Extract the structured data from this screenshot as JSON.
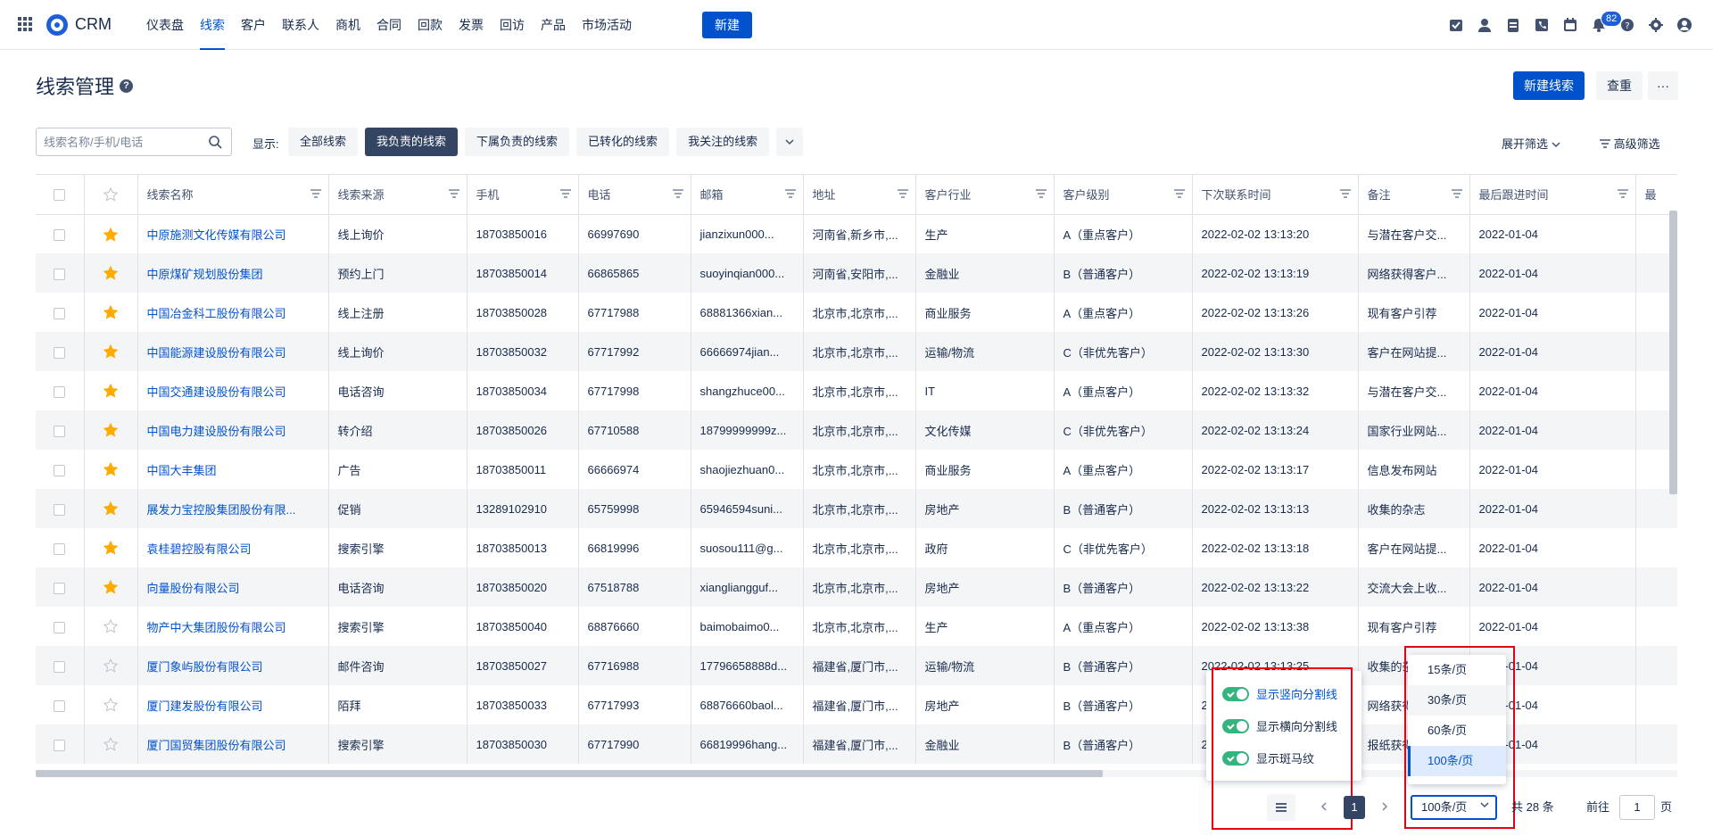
{
  "nav": {
    "brand": "CRM",
    "items": [
      "仪表盘",
      "线索",
      "客户",
      "联系人",
      "商机",
      "合同",
      "回款",
      "发票",
      "回访",
      "产品",
      "市场活动"
    ],
    "active_index": 1,
    "new_label": "新建",
    "notification_count": "82",
    "icons": [
      "task-icon",
      "user-icon",
      "document-icon",
      "phone-icon",
      "calendar-icon",
      "bell-icon",
      "help-icon",
      "gear-icon",
      "avatar-icon"
    ]
  },
  "page": {
    "title": "线索管理",
    "help": "?",
    "new_lead_label": "新建线索",
    "dedupe_label": "查重",
    "more_label": "···"
  },
  "toolbar": {
    "search_placeholder": "线索名称/手机/电话",
    "show_label": "显示:",
    "filters": [
      "全部线索",
      "我负责的线索",
      "下属负责的线索",
      "已转化的线索",
      "我关注的线索"
    ],
    "active_filter": 1,
    "expand_label": "展开筛选",
    "advanced_label": "高级筛选"
  },
  "table": {
    "columns": [
      "线索名称",
      "线索来源",
      "手机",
      "电话",
      "邮箱",
      "地址",
      "客户行业",
      "客户级别",
      "下次联系时间",
      "备注",
      "最后跟进时间",
      "最"
    ],
    "rows": [
      {
        "starred": true,
        "cells": [
          "中原施测文化传媒有限公司",
          "线上询价",
          "18703850016",
          "66997690",
          "jianzixun000...",
          "河南省,新乡市,...",
          "生产",
          "A（重点客户）",
          "2022-02-02 13:13:20",
          "与潜在客户交...",
          "2022-01-04"
        ]
      },
      {
        "starred": true,
        "cells": [
          "中原煤矿规划股份集团",
          "预约上门",
          "18703850014",
          "66865865",
          "suoyinqian000...",
          "河南省,安阳市,...",
          "金融业",
          "B（普通客户）",
          "2022-02-02 13:13:19",
          "网络获得客户...",
          "2022-01-04"
        ]
      },
      {
        "starred": true,
        "cells": [
          "中国冶金科工股份有限公司",
          "线上注册",
          "18703850028",
          "67717988",
          "68881366xian...",
          "北京市,北京市,...",
          "商业服务",
          "A（重点客户）",
          "2022-02-02 13:13:26",
          "现有客户引荐",
          "2022-01-04"
        ]
      },
      {
        "starred": true,
        "cells": [
          "中国能源建设股份有限公司",
          "线上询价",
          "18703850032",
          "67717992",
          "66666974jian...",
          "北京市,北京市,...",
          "运输/物流",
          "C（非优先客户）",
          "2022-02-02 13:13:30",
          "客户在网站提...",
          "2022-01-04"
        ]
      },
      {
        "starred": true,
        "cells": [
          "中国交通建设股份有限公司",
          "电话咨询",
          "18703850034",
          "67717998",
          "shangzhuce00...",
          "北京市,北京市,...",
          "IT",
          "A（重点客户）",
          "2022-02-02 13:13:32",
          "与潜在客户交...",
          "2022-01-04"
        ]
      },
      {
        "starred": true,
        "cells": [
          "中国电力建设股份有限公司",
          "转介绍",
          "18703850026",
          "67710588",
          "18799999999z...",
          "北京市,北京市,...",
          "文化传媒",
          "C（非优先客户）",
          "2022-02-02 13:13:24",
          "国家行业网站...",
          "2022-01-04"
        ]
      },
      {
        "starred": true,
        "cells": [
          "中国大丰集团",
          "广告",
          "18703850011",
          "66666974",
          "shaojiezhuan0...",
          "北京市,北京市,...",
          "商业服务",
          "A（重点客户）",
          "2022-02-02 13:13:17",
          "信息发布网站",
          "2022-01-04"
        ]
      },
      {
        "starred": true,
        "cells": [
          "展发力宝控股集团股份有限...",
          "促销",
          "13289102910",
          "65759998",
          "65946594suni...",
          "北京市,北京市,...",
          "房地产",
          "B（普通客户）",
          "2022-02-02 13:13:13",
          "收集的杂志",
          "2022-01-04"
        ]
      },
      {
        "starred": true,
        "cells": [
          "袁桂碧控股有限公司",
          "搜索引擎",
          "18703850013",
          "66819996",
          "suosou111@g...",
          "北京市,北京市,...",
          "政府",
          "C（非优先客户）",
          "2022-02-02 13:13:18",
          "客户在网站提...",
          "2022-01-04"
        ]
      },
      {
        "starred": true,
        "cells": [
          "向量股份有限公司",
          "电话咨询",
          "18703850020",
          "67518788",
          "xiangliangguf...",
          "北京市,北京市,...",
          "房地产",
          "B（普通客户）",
          "2022-02-02 13:13:22",
          "交流大会上收...",
          "2022-01-04"
        ]
      },
      {
        "starred": false,
        "cells": [
          "物产中大集团股份有限公司",
          "搜索引擎",
          "18703850040",
          "68876660",
          "baimobaimo0...",
          "北京市,北京市,...",
          "生产",
          "A（重点客户）",
          "2022-02-02 13:13:38",
          "现有客户引荐",
          "2022-01-04"
        ]
      },
      {
        "starred": false,
        "cells": [
          "厦门象屿股份有限公司",
          "邮件咨询",
          "18703850027",
          "67716988",
          "17796658888d...",
          "福建省,厦门市,...",
          "运输/物流",
          "B（普通客户）",
          "2022-02-02 13:13:25",
          "收集的杂志",
          "2022-01-04"
        ]
      },
      {
        "starred": false,
        "cells": [
          "厦门建发股份有限公司",
          "陌拜",
          "18703850033",
          "67717993",
          "68876660baol...",
          "福建省,厦门市,...",
          "房地产",
          "B（普通客户）",
          "2022-02-02 13:13:31",
          "网络获得客户...",
          "2022-01-04"
        ]
      },
      {
        "starred": false,
        "cells": [
          "厦门国贸集团股份有限公司",
          "搜索引擎",
          "18703850030",
          "67717990",
          "66819996hang...",
          "福建省,厦门市,...",
          "金融业",
          "B（普通客户）",
          "2022-02-02 13:13:28",
          "报纸获得",
          "2022-01-04"
        ]
      }
    ]
  },
  "settings_popover": {
    "options": [
      "显示竖向分割线",
      "显示横向分割线",
      "显示斑马纹"
    ]
  },
  "page_size_dropdown": {
    "options": [
      "15条/页",
      "30条/页",
      "60条/页",
      "100条/页"
    ],
    "selected_index": 3
  },
  "pager": {
    "current_page": "1",
    "page_size": "100条/页",
    "total": "共 28 条",
    "goto_label": "前往",
    "goto_value": "1",
    "page_unit": "页"
  },
  "colors": {
    "primary": "#0052cc",
    "star": "#ffab00",
    "dark": "#344563",
    "toggle": "#36b37e",
    "highlight_box": "#e60012"
  }
}
